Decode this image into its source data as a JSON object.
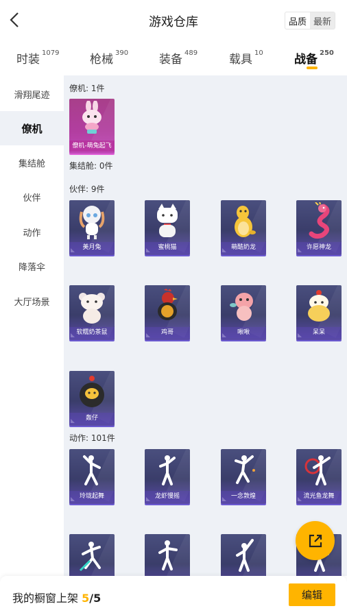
{
  "header": {
    "title": "游戏仓库",
    "sort_options": [
      "品质",
      "最新"
    ]
  },
  "tabs": [
    {
      "label": "时装",
      "count": "1079"
    },
    {
      "label": "枪械",
      "count": "390"
    },
    {
      "label": "装备",
      "count": "489"
    },
    {
      "label": "载具",
      "count": "10"
    },
    {
      "label": "战备",
      "count": "250",
      "active": true
    }
  ],
  "sidebar": {
    "items": [
      {
        "label": "滑翔尾迹"
      },
      {
        "label": "僚机",
        "active": true
      },
      {
        "label": "集结舱"
      },
      {
        "label": "伙伴"
      },
      {
        "label": "动作"
      },
      {
        "label": "降落伞"
      },
      {
        "label": "大厅场景"
      }
    ]
  },
  "sections": {
    "wingman": {
      "title": "僚机: 1件",
      "items": [
        {
          "name": "僚机-萌兔起飞",
          "icon": "pink-bunny-icon"
        }
      ]
    },
    "capsule": {
      "title": "集结舱: 0件"
    },
    "partner": {
      "title": "伙伴: 9件",
      "items": [
        {
          "name": "美月兔",
          "icon": "doll-bunny-icon"
        },
        {
          "name": "蜜桃猫",
          "icon": "white-cat-icon"
        },
        {
          "name": "萌酷奶龙",
          "icon": "yellow-dragon-icon"
        },
        {
          "name": "许愿神龙",
          "icon": "pink-dragon-icon"
        },
        {
          "name": "软糯奶茶鼠",
          "icon": "hamster-icon"
        },
        {
          "name": "鸡哥",
          "icon": "rooster-icon"
        },
        {
          "name": "啾啾",
          "icon": "pink-bird-icon"
        },
        {
          "name": "呆呆",
          "icon": "chick-icon"
        },
        {
          "name": "轰仔",
          "icon": "bomb-chick-icon"
        }
      ]
    },
    "emote": {
      "title": "动作: 101件",
      "items": [
        {
          "name": "玲珑起舞",
          "icon": "dance-pose-icon"
        },
        {
          "name": "龙虾慢摇",
          "icon": "dance-pose-icon"
        },
        {
          "name": "一念敦煌",
          "icon": "dance-pose-icon"
        },
        {
          "name": "流光鱼龙舞",
          "icon": "dance-pose-icon"
        },
        {
          "name": "",
          "icon": "dance-pose-icon"
        },
        {
          "name": "",
          "icon": "dance-pose-icon"
        },
        {
          "name": "",
          "icon": "dance-pose-icon"
        },
        {
          "name": "",
          "icon": "dance-pose-icon"
        }
      ]
    }
  },
  "shelf": {
    "label": "我的橱窗上架",
    "current": "5",
    "separator": "/",
    "max": "5",
    "edit_label": "编辑"
  },
  "colors": {
    "accent": "#ffb400",
    "card_purple": "#4a4f7e",
    "card_pink": "#b23ea0",
    "content_bg": "#eef1f6"
  }
}
